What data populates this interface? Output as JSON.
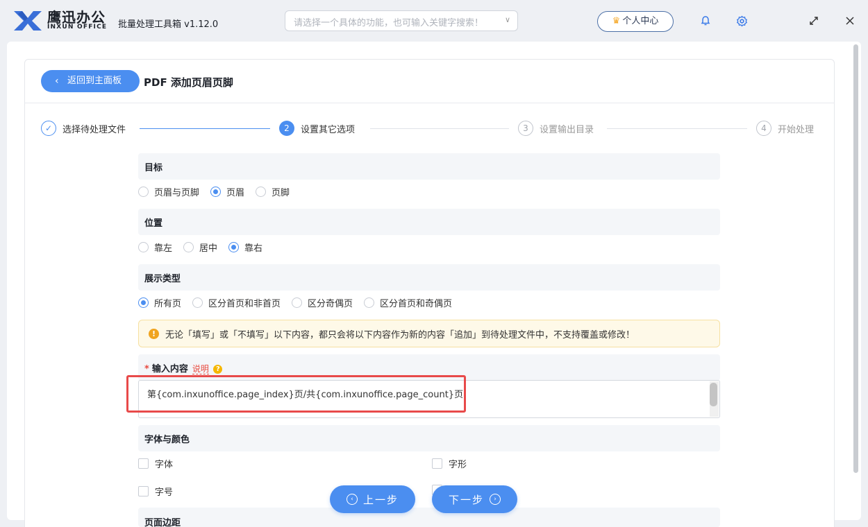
{
  "app": {
    "brand_cn": "鹰迅办公",
    "brand_en": "INXUN OFFICE",
    "title": "批量处理工具箱 v1.12.0",
    "search_placeholder": "请选择一个具体的功能，也可输入关键字搜索！",
    "user_center": "个人中心",
    "icons": [
      "logo-icon",
      "bell-icon",
      "gear-icon",
      "maximize-icon",
      "close-icon",
      "crown-icon"
    ]
  },
  "header": {
    "back": "返回到主面板",
    "title": "PDF 添加页眉页脚"
  },
  "steps": [
    {
      "num": "✓",
      "label": "选择待处理文件",
      "state": "done"
    },
    {
      "num": "2",
      "label": "设置其它选项",
      "state": "active"
    },
    {
      "num": "3",
      "label": "设置输出目录",
      "state": "todo"
    },
    {
      "num": "4",
      "label": "开始处理",
      "state": "todo"
    }
  ],
  "target": {
    "title": "目标",
    "options": [
      "页眉与页脚",
      "页眉",
      "页脚"
    ],
    "selected": "页眉"
  },
  "position": {
    "title": "位置",
    "options": [
      "靠左",
      "居中",
      "靠右"
    ],
    "selected": "靠右"
  },
  "display": {
    "title": "展示类型",
    "options": [
      "所有页",
      "区分首页和非首页",
      "区分奇偶页",
      "区分首页和奇偶页"
    ],
    "selected": "所有页"
  },
  "alert": "无论「填写」或「不填写」以下内容，都只会将以下内容作为新的内容「追加」到待处理文件中，不支持覆盖或修改！",
  "content": {
    "required_mark": "*",
    "title": "输入内容",
    "hint": "说明",
    "hint_icon": "?",
    "value": "第{com.inxunoffice.page_index}页/共{com.inxunoffice.page_count}页"
  },
  "font": {
    "title": "字体与颜色",
    "font_label": "字体",
    "style_label": "字形",
    "size_label": "字号"
  },
  "margin_title": "页面边距",
  "buttons": {
    "prev": "上一步",
    "next": "下一步"
  },
  "colors": {
    "accent": "#4b8ef0",
    "highlight": "#e84a4a",
    "alert_bg": "#fef9e8"
  }
}
